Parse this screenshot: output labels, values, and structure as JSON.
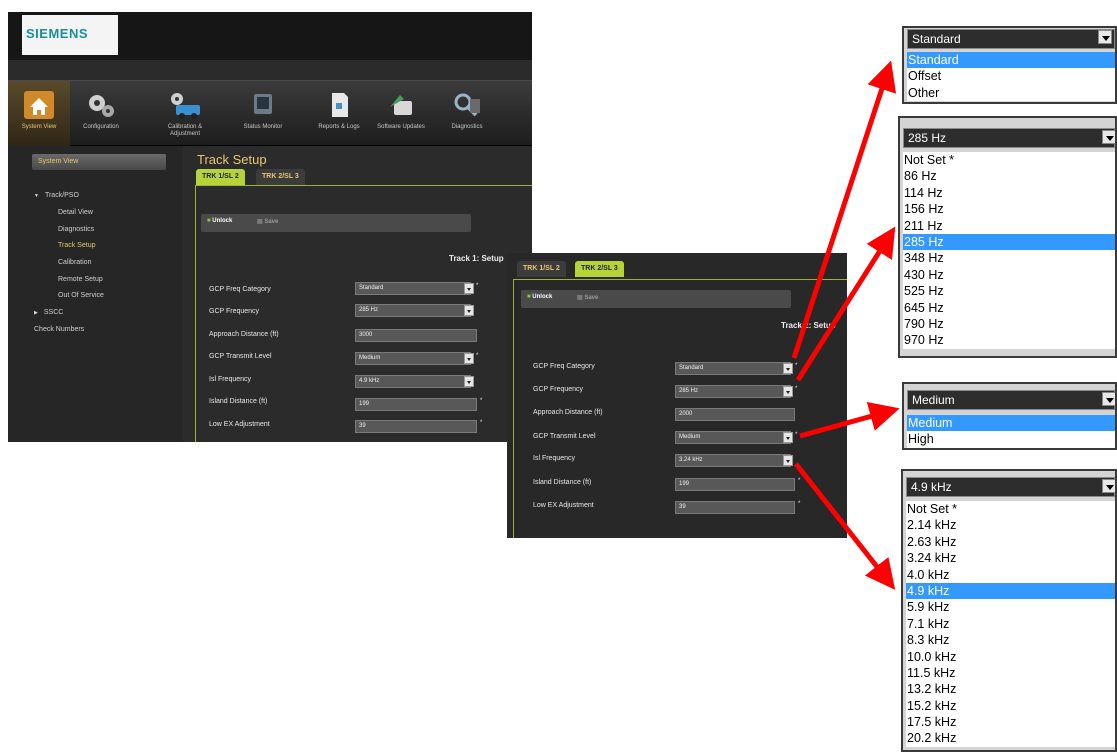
{
  "brand": {
    "logo": "SIEMENS"
  },
  "toolbar": {
    "items": [
      {
        "label": "System View",
        "icon": "house-icon",
        "active": true
      },
      {
        "label": "Configuration",
        "icon": "gears-icon"
      },
      {
        "label": "Calibration & Adjustment",
        "icon": "calibration-icon"
      },
      {
        "label": "Status Monitor",
        "icon": "monitor-icon"
      },
      {
        "label": "Reports & Logs",
        "icon": "report-icon"
      },
      {
        "label": "Software Updates",
        "icon": "update-icon"
      },
      {
        "label": "Diagnostics",
        "icon": "magnifier-icon"
      }
    ]
  },
  "nav": {
    "header": "System View",
    "items": [
      {
        "label": "Track/PSO",
        "level": "top",
        "expanded": true
      },
      {
        "label": "Detail View",
        "level": "sub"
      },
      {
        "label": "Diagnostics",
        "level": "sub"
      },
      {
        "label": "Track Setup",
        "level": "sub",
        "selected": true
      },
      {
        "label": "Calibration",
        "level": "sub"
      },
      {
        "label": "Remote Setup",
        "level": "sub"
      },
      {
        "label": "Out Of Service",
        "level": "sub"
      },
      {
        "label": "SSCC",
        "level": "top",
        "expanded": false
      },
      {
        "label": "Check Numbers",
        "level": "top"
      }
    ]
  },
  "main": {
    "title": "Track Setup",
    "tabs": [
      {
        "label": "TRK 1/SL 2",
        "active": true
      },
      {
        "label": "TRK 2/SL 3",
        "active": false
      }
    ],
    "buttons": {
      "unlock": "Unlock",
      "save": "Save"
    },
    "section_title": "Track 1: Setup",
    "fields": [
      {
        "label": "GCP Freq Category",
        "value": "Standard",
        "dropdown": true,
        "star": true
      },
      {
        "label": "GCP Frequency",
        "value": "285 Hz",
        "dropdown": true,
        "star": false
      },
      {
        "label": "Approach Distance (ft)",
        "value": "3000",
        "dropdown": false,
        "star": false
      },
      {
        "label": "GCP Transmit Level",
        "value": "Medium",
        "dropdown": true,
        "star": true
      },
      {
        "label": "Isl Frequency",
        "value": "4.9 kHz",
        "dropdown": true,
        "star": false
      },
      {
        "label": "Island Distance (ft)",
        "value": "199",
        "dropdown": false,
        "star": true
      },
      {
        "label": "Low EX Adjustment",
        "value": "39",
        "dropdown": false,
        "star": true
      }
    ]
  },
  "second": {
    "tabs": [
      {
        "label": "TRK 1/SL 2",
        "active": false
      },
      {
        "label": "TRK 2/SL 3",
        "active": true
      }
    ],
    "buttons": {
      "unlock": "Unlock",
      "save": "Save"
    },
    "section_title": "Track 2: Setup",
    "fields": [
      {
        "label": "GCP Freq Category",
        "value": "Standard",
        "dropdown": true,
        "star": true
      },
      {
        "label": "GCP Frequency",
        "value": "285 Hz",
        "dropdown": true,
        "star": true
      },
      {
        "label": "Approach Distance (ft)",
        "value": "2000",
        "dropdown": false,
        "star": false
      },
      {
        "label": "GCP Transmit Level",
        "value": "Medium",
        "dropdown": true,
        "star": true
      },
      {
        "label": "Isl Frequency",
        "value": "3.24 kHz",
        "dropdown": true,
        "star": false
      },
      {
        "label": "Island Distance (ft)",
        "value": "199",
        "dropdown": false,
        "star": true
      },
      {
        "label": "Low EX Adjustment",
        "value": "39",
        "dropdown": false,
        "star": true
      }
    ]
  },
  "popups": [
    {
      "name": "freq-category",
      "header": "Standard",
      "options": [
        "Standard",
        "Offset",
        "Other"
      ],
      "selected": 0
    },
    {
      "name": "gcp-frequency",
      "header": "285 Hz",
      "options": [
        "Not Set *",
        "86 Hz",
        "114 Hz",
        "156 Hz",
        "211 Hz",
        "285 Hz",
        "348 Hz",
        "430 Hz",
        "525 Hz",
        "645 Hz",
        "790 Hz",
        "970 Hz"
      ],
      "selected": 5
    },
    {
      "name": "transmit-level",
      "header": "Medium",
      "options": [
        "Medium",
        "High"
      ],
      "selected": 0
    },
    {
      "name": "isl-frequency",
      "header": "4.9 kHz",
      "options": [
        "Not Set *",
        "2.14 kHz",
        "2.63 kHz",
        "3.24 kHz",
        "4.0 kHz",
        "4.9 kHz",
        "5.9 kHz",
        "7.1 kHz",
        "8.3 kHz",
        "10.0 kHz",
        "11.5 kHz",
        "13.2 kHz",
        "15.2 kHz",
        "17.5 kHz",
        "20.2 kHz"
      ],
      "selected": 5
    }
  ],
  "colors": {
    "accent": "#e6c870",
    "tab_active": "#b6d43a",
    "selection": "#3399ff",
    "arrow": "#ff0000"
  }
}
